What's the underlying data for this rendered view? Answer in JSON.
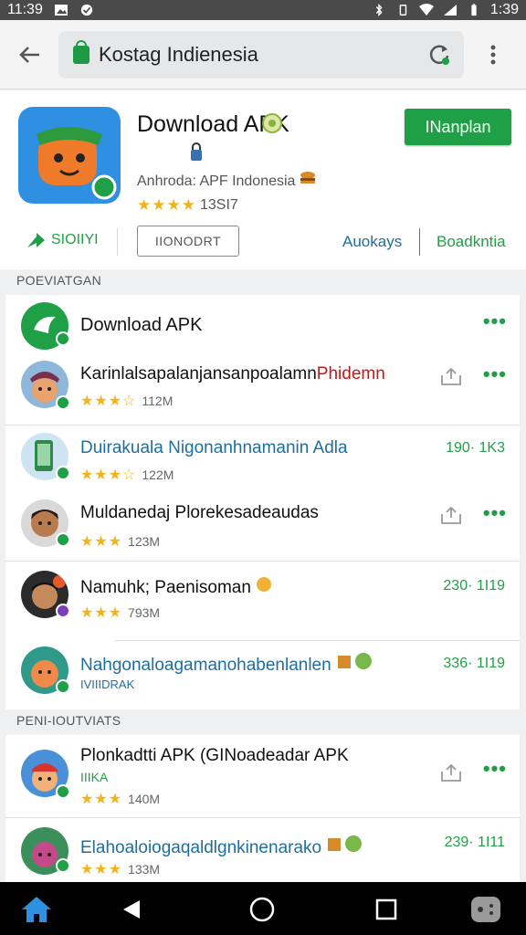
{
  "status_bar": {
    "time_left": "11:39",
    "time_right": "1:39"
  },
  "browser": {
    "url_text": "Kostag Indienesia"
  },
  "app": {
    "title": "Download APK",
    "subtitle": "Anhroda: APF Indonesia",
    "rating_stars": "★★★★",
    "rating_count": "13SI7",
    "install_label": "INanplan",
    "share_label": "SIOIIYI",
    "action_button_label": "IIONODRT",
    "link_a": "Auokays",
    "link_b": "Boadkntia"
  },
  "section1_label": "POEVIATGAN",
  "section2_label": "PENI-IOUTVIATS",
  "list1": [
    {
      "title": "Download APK",
      "stars": "",
      "meta": "",
      "right": "dots"
    },
    {
      "title": "Karinlalsapalanjansanpoalamn",
      "title_accent": "Phidemn",
      "stars": "★★★☆",
      "meta": "112M",
      "right": "share-dots"
    },
    {
      "title": "Duirakuala Nigonanhnamanin Adla",
      "stars": "★★★☆",
      "meta": "122M",
      "right": "size",
      "size": "190· 1K3"
    },
    {
      "title": "Muldanedaj Plorekesadeaudas",
      "stars": "★★★",
      "meta": "123M",
      "right": "share-dots"
    },
    {
      "title": "Namuhk; Paenisoman",
      "stars": "★★★",
      "meta": "793M",
      "right": "size",
      "size": "230· 1I19"
    },
    {
      "title": "Nahgonaloagamanohabenlanlen",
      "stars": "",
      "meta": "IVIIIDRAK",
      "right": "size",
      "size": "336· 1I19"
    }
  ],
  "list2": [
    {
      "title": "Plonkadtti APK (GINoadeadar APK",
      "sub": "IIIKA",
      "stars": "★★★",
      "meta": "140M",
      "right": "share-dots"
    },
    {
      "title": "Elahoaloiogaqaldlgnkinenarako",
      "stars": "★★★",
      "meta": "133M",
      "right": "size",
      "size": "239· 1I11"
    }
  ],
  "colors": {
    "accent_green": "#1fa046",
    "link_blue": "#1e6e9e",
    "star_yellow": "#f1b41a",
    "title_red": "#c31818"
  }
}
